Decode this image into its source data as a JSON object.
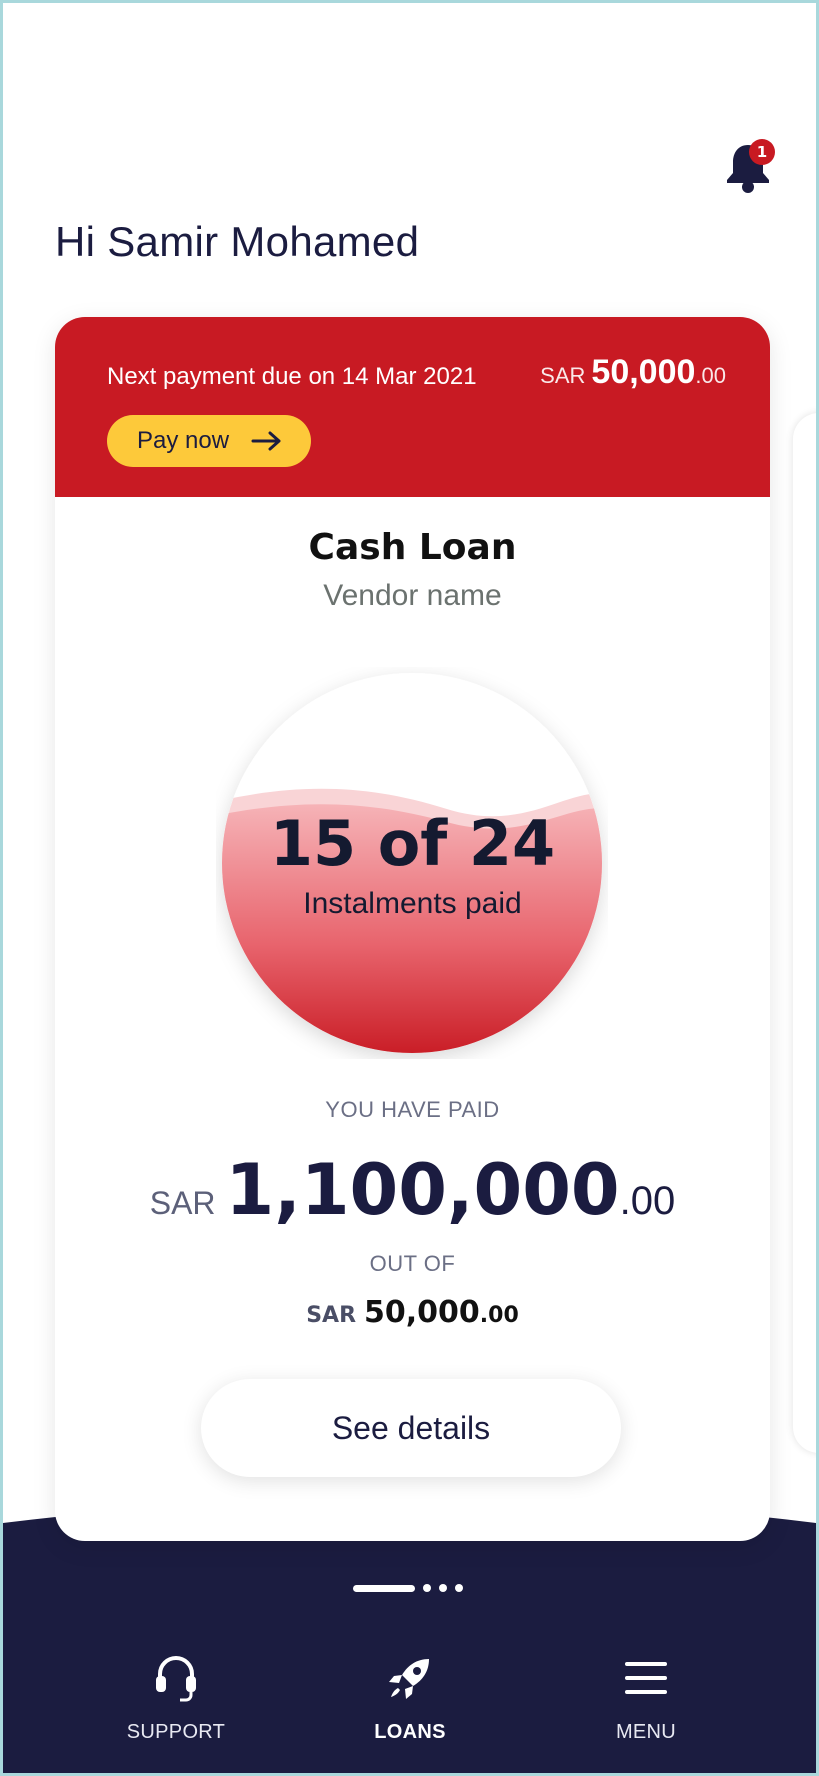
{
  "header": {
    "notification_count": "1",
    "greeting": "Hi Samir Mohamed"
  },
  "payment_banner": {
    "due_text": "Next payment due on 14 Mar 2021",
    "currency": "SAR",
    "amount_main": "50,000",
    "amount_decimal": ".00",
    "pay_button_label": "Pay now"
  },
  "loan": {
    "title": "Cash Loan",
    "vendor": "Vendor name",
    "instalments_paid": 15,
    "instalments_total": 24,
    "instalments_text": "15 of 24",
    "instalments_label": "Instalments paid",
    "paid_caption": "YOU HAVE PAID",
    "paid_currency": "SAR",
    "paid_main": "1,100,000",
    "paid_decimal": ".00",
    "out_of_caption": "OUT OF",
    "total_currency": "SAR",
    "total_main": "50,000",
    "total_decimal": ".00",
    "details_button_label": "See details"
  },
  "pager": {
    "pages": 4,
    "active_index": 0
  },
  "bottom_nav": {
    "items": [
      {
        "label": "SUPPORT",
        "icon": "headset-icon",
        "active": false
      },
      {
        "label": "LOANS",
        "icon": "rocket-icon",
        "active": true
      },
      {
        "label": "MENU",
        "icon": "hamburger-menu-icon",
        "active": false
      }
    ]
  },
  "colors": {
    "brand_red": "#c81a23",
    "accent_yellow": "#fdc93a",
    "navy": "#1b1c40"
  }
}
